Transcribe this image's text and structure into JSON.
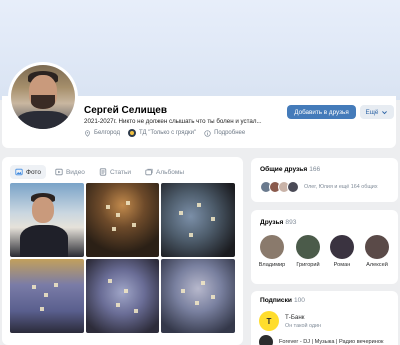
{
  "profile": {
    "name": "Сергей Селищев",
    "status": "2021-2027г. Никто не должен слышать что ты болен и устал...",
    "location": "Белгород",
    "organization": "ТД \"Только с грядки\"",
    "details": "Подробнее",
    "add_friend": "Добавить в друзья",
    "more": "Ещё"
  },
  "photos": {
    "tabs": [
      {
        "label": "Фото",
        "icon": "image-icon"
      },
      {
        "label": "Видео",
        "icon": "video-icon"
      },
      {
        "label": "Статьи",
        "icon": "article-icon"
      },
      {
        "label": "Альбомы",
        "icon": "albums-icon"
      }
    ]
  },
  "common_friends": {
    "title": "Общие друзья",
    "count": "166",
    "text": "Олег, Юлия и ещё 164 общих"
  },
  "friends": {
    "title": "Друзья",
    "count": "893",
    "items": [
      {
        "name": "Владимир",
        "color": "#8a7a6c"
      },
      {
        "name": "Григорий",
        "color": "#4b5b4a"
      },
      {
        "name": "Роман",
        "color": "#3a3340"
      },
      {
        "name": "Алексей",
        "color": "#5a4a48"
      }
    ]
  },
  "subscriptions": {
    "title": "Подписки",
    "count": "100",
    "items": [
      {
        "name": "Т-Банк",
        "desc": "Он такой один",
        "logo_text": "Т",
        "color": "#ffdd2d"
      },
      {
        "name": "Forever - DJ | Музыка | Радио вечеринок",
        "desc": "",
        "logo_text": "",
        "color": "#2c2d2e"
      }
    ]
  },
  "colors": {
    "accent": "#447bba",
    "muted": "#818c99"
  }
}
